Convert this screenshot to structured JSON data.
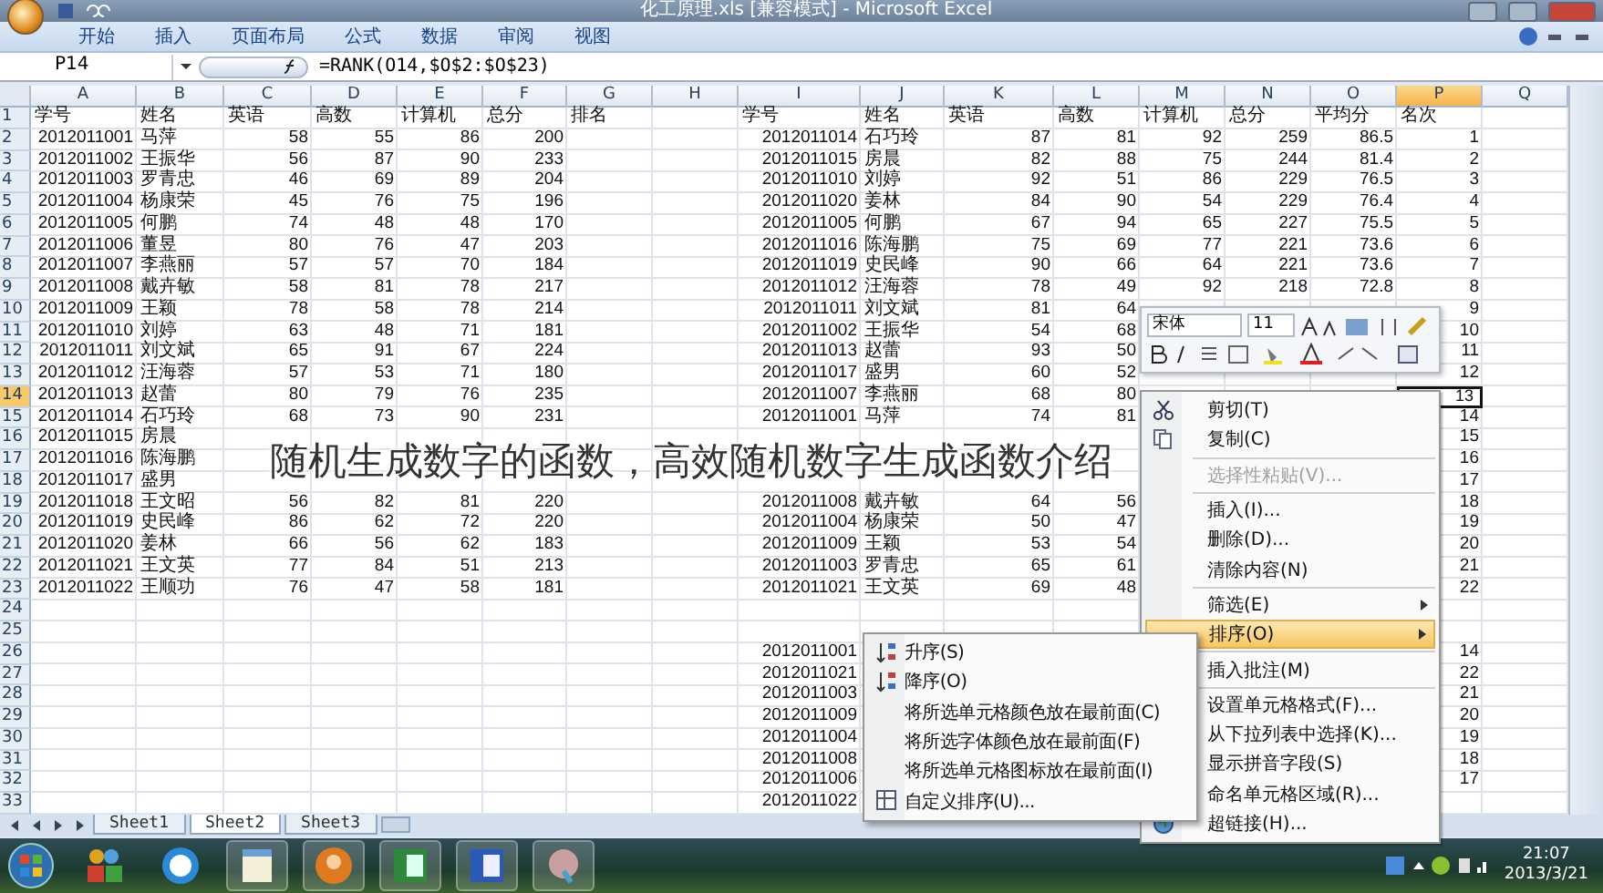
{
  "window": {
    "title": "化工原理.xls [兼容模式] - Microsoft Excel"
  },
  "ribbon_tabs": [
    "开始",
    "插入",
    "页面布局",
    "公式",
    "数据",
    "审阅",
    "视图"
  ],
  "formula_bar": {
    "name_box": "P14",
    "formula": "=RANK(O14,$O$2:$O$23)"
  },
  "columns": [
    {
      "label": "A",
      "selected": false
    },
    {
      "label": "B",
      "selected": false
    },
    {
      "label": "C",
      "selected": false
    },
    {
      "label": "D",
      "selected": false
    },
    {
      "label": "E",
      "selected": false
    },
    {
      "label": "F",
      "selected": false
    },
    {
      "label": "G",
      "selected": false
    },
    {
      "label": "H",
      "selected": false
    },
    {
      "label": "I",
      "selected": false
    },
    {
      "label": "J",
      "selected": false
    },
    {
      "label": "K",
      "selected": false
    },
    {
      "label": "L",
      "selected": false
    },
    {
      "label": "M",
      "selected": false
    },
    {
      "label": "N",
      "selected": false
    },
    {
      "label": "O",
      "selected": false
    },
    {
      "label": "P",
      "selected": true
    },
    {
      "label": "Q",
      "selected": false
    }
  ],
  "rows": [
    {
      "header": "1",
      "selected": false,
      "cells": {
        "A": "学号",
        "B": "姓名",
        "C": "英语",
        "D": "高数",
        "E": "计算机",
        "F": "总分",
        "G": "排名",
        "I": "学号",
        "J": "姓名",
        "K": "英语",
        "L": "高数",
        "M": "计算机",
        "N": "总分",
        "O": "平均分",
        "P": "名次"
      }
    },
    {
      "header": "2",
      "selected": false,
      "cells": {
        "A": "2012011001",
        "B": "马萍",
        "C": "58",
        "D": "55",
        "E": "86",
        "F": "200",
        "I": "2012011014",
        "J": "石巧玲",
        "K": "87",
        "L": "81",
        "M": "92",
        "N": "259",
        "O": "86.5",
        "P": "1"
      }
    },
    {
      "header": "3",
      "selected": false,
      "cells": {
        "A": "2012011002",
        "B": "王振华",
        "C": "56",
        "D": "87",
        "E": "90",
        "F": "233",
        "I": "2012011015",
        "J": "房晨",
        "K": "82",
        "L": "88",
        "M": "75",
        "N": "244",
        "O": "81.4",
        "P": "2"
      }
    },
    {
      "header": "4",
      "selected": false,
      "cells": {
        "A": "2012011003",
        "B": "罗青忠",
        "C": "46",
        "D": "69",
        "E": "89",
        "F": "204",
        "I": "2012011010",
        "J": "刘婷",
        "K": "92",
        "L": "51",
        "M": "86",
        "N": "229",
        "O": "76.5",
        "P": "3"
      }
    },
    {
      "header": "5",
      "selected": false,
      "cells": {
        "A": "2012011004",
        "B": "杨康荣",
        "C": "45",
        "D": "76",
        "E": "75",
        "F": "196",
        "I": "2012011020",
        "J": "姜林",
        "K": "84",
        "L": "90",
        "M": "54",
        "N": "229",
        "O": "76.4",
        "P": "4"
      }
    },
    {
      "header": "6",
      "selected": false,
      "cells": {
        "A": "2012011005",
        "B": "何鹏",
        "C": "74",
        "D": "48",
        "E": "48",
        "F": "170",
        "I": "2012011005",
        "J": "何鹏",
        "K": "67",
        "L": "94",
        "M": "65",
        "N": "227",
        "O": "75.5",
        "P": "5"
      }
    },
    {
      "header": "7",
      "selected": false,
      "cells": {
        "A": "2012011006",
        "B": "董昱",
        "C": "80",
        "D": "76",
        "E": "47",
        "F": "203",
        "I": "2012011016",
        "J": "陈海鹏",
        "K": "75",
        "L": "69",
        "M": "77",
        "N": "221",
        "O": "73.6",
        "P": "6"
      }
    },
    {
      "header": "8",
      "selected": false,
      "cells": {
        "A": "2012011007",
        "B": "李燕丽",
        "C": "57",
        "D": "57",
        "E": "70",
        "F": "184",
        "I": "2012011019",
        "J": "史民峰",
        "K": "90",
        "L": "66",
        "M": "64",
        "N": "221",
        "O": "73.6",
        "P": "7"
      }
    },
    {
      "header": "9",
      "selected": false,
      "cells": {
        "A": "2012011008",
        "B": "戴卉敏",
        "C": "58",
        "D": "81",
        "E": "78",
        "F": "217",
        "I": "2012011012",
        "J": "汪海蓉",
        "K": "78",
        "L": "49",
        "M": "92",
        "N": "218",
        "O": "72.8",
        "P": "8"
      }
    },
    {
      "header": "10",
      "selected": false,
      "cells": {
        "A": "2012011009",
        "B": "王颖",
        "C": "78",
        "D": "58",
        "E": "78",
        "F": "214",
        "I": "2012011011",
        "J": "刘文斌",
        "K": "81",
        "L": "64",
        "P": "9"
      }
    },
    {
      "header": "11",
      "selected": false,
      "cells": {
        "A": "2012011010",
        "B": "刘婷",
        "C": "63",
        "D": "48",
        "E": "71",
        "F": "181",
        "I": "2012011002",
        "J": "王振华",
        "K": "54",
        "L": "68",
        "P": "10"
      }
    },
    {
      "header": "12",
      "selected": false,
      "cells": {
        "A": "2012011011",
        "B": "刘文斌",
        "C": "65",
        "D": "91",
        "E": "67",
        "F": "224",
        "I": "2012011013",
        "J": "赵蕾",
        "K": "93",
        "L": "50",
        "P": "11"
      }
    },
    {
      "header": "13",
      "selected": false,
      "cells": {
        "A": "2012011012",
        "B": "汪海蓉",
        "C": "57",
        "D": "53",
        "E": "71",
        "F": "180",
        "I": "2012011017",
        "J": "盛男",
        "K": "60",
        "L": "52",
        "P": "12"
      }
    },
    {
      "header": "14",
      "selected": true,
      "cells": {
        "A": "2012011013",
        "B": "赵蕾",
        "C": "80",
        "D": "79",
        "E": "76",
        "F": "235",
        "I": "2012011007",
        "J": "李燕丽",
        "K": "68",
        "L": "80",
        "P": "13"
      }
    },
    {
      "header": "15",
      "selected": false,
      "cells": {
        "A": "2012011014",
        "B": "石巧玲",
        "C": "68",
        "D": "73",
        "E": "90",
        "F": "231",
        "I": "2012011001",
        "J": "马萍",
        "K": "74",
        "L": "81",
        "P": "14"
      }
    },
    {
      "header": "16",
      "selected": false,
      "cells": {
        "A": "2012011015",
        "B": "房晨",
        "P": "15"
      }
    },
    {
      "header": "17",
      "selected": false,
      "cells": {
        "A": "2012011016",
        "B": "陈海鹏",
        "P": "16"
      }
    },
    {
      "header": "18",
      "selected": false,
      "cells": {
        "A": "2012011017",
        "B": "盛男",
        "P": "17"
      }
    },
    {
      "header": "19",
      "selected": false,
      "cells": {
        "A": "2012011018",
        "B": "王文昭",
        "C": "56",
        "D": "82",
        "E": "81",
        "F": "220",
        "I": "2012011008",
        "J": "戴卉敏",
        "K": "64",
        "L": "56",
        "P": "18"
      }
    },
    {
      "header": "20",
      "selected": false,
      "cells": {
        "A": "2012011019",
        "B": "史民峰",
        "C": "86",
        "D": "62",
        "E": "72",
        "F": "220",
        "I": "2012011004",
        "J": "杨康荣",
        "K": "50",
        "L": "47",
        "P": "19"
      }
    },
    {
      "header": "21",
      "selected": false,
      "cells": {
        "A": "2012011020",
        "B": "姜林",
        "C": "66",
        "D": "56",
        "E": "62",
        "F": "183",
        "I": "2012011009",
        "J": "王颖",
        "K": "53",
        "L": "54",
        "P": "20"
      }
    },
    {
      "header": "22",
      "selected": false,
      "cells": {
        "A": "2012011021",
        "B": "王文英",
        "C": "77",
        "D": "84",
        "E": "51",
        "F": "213",
        "I": "2012011003",
        "J": "罗青忠",
        "K": "65",
        "L": "61",
        "P": "21"
      }
    },
    {
      "header": "23",
      "selected": false,
      "cells": {
        "A": "2012011022",
        "B": "王顺功",
        "C": "76",
        "D": "47",
        "E": "58",
        "F": "181",
        "I": "2012011021",
        "J": "王文英",
        "K": "69",
        "L": "48",
        "P": "22"
      }
    },
    {
      "header": "24",
      "selected": false
    },
    {
      "header": "25",
      "selected": false
    },
    {
      "header": "26",
      "selected": false,
      "cells": {
        "I": "2012011001",
        "P": "14"
      }
    },
    {
      "header": "27",
      "selected": false,
      "cells": {
        "I": "2012011021",
        "P": "22"
      }
    },
    {
      "header": "28",
      "selected": false,
      "cells": {
        "I": "2012011003",
        "P": "21"
      }
    },
    {
      "header": "29",
      "selected": false,
      "cells": {
        "I": "2012011009",
        "P": "20"
      }
    },
    {
      "header": "30",
      "selected": false,
      "cells": {
        "I": "2012011004",
        "P": "19"
      }
    },
    {
      "header": "31",
      "selected": false,
      "cells": {
        "I": "2012011008",
        "P": "18"
      }
    },
    {
      "header": "32",
      "selected": false,
      "cells": {
        "I": "2012011006",
        "P": "17"
      }
    },
    {
      "header": "33",
      "selected": false,
      "cells": {
        "I": "2012011022"
      }
    }
  ],
  "sheet_tabs": [
    {
      "label": "Sheet1",
      "selected": false
    },
    {
      "label": "Sheet2",
      "selected": true
    },
    {
      "label": "Sheet3",
      "selected": false
    }
  ],
  "mini_toolbar": {
    "font": "宋体",
    "size": "11"
  },
  "context_menu": [
    {
      "kind": "item",
      "label": "剪切(T)",
      "disabled": false,
      "highlighted": false,
      "submenu": false
    },
    {
      "kind": "item",
      "label": "复制(C)",
      "disabled": false,
      "highlighted": false,
      "submenu": false
    },
    {
      "kind": "separator"
    },
    {
      "kind": "item",
      "label": "选择性粘贴(V)...",
      "disabled": true,
      "highlighted": false,
      "submenu": false
    },
    {
      "kind": "separator"
    },
    {
      "kind": "item",
      "label": "插入(I)...",
      "disabled": false,
      "highlighted": false,
      "submenu": false
    },
    {
      "kind": "item",
      "label": "删除(D)...",
      "disabled": false,
      "highlighted": false,
      "submenu": false
    },
    {
      "kind": "item",
      "label": "清除内容(N)",
      "disabled": false,
      "highlighted": false,
      "submenu": false
    },
    {
      "kind": "separator"
    },
    {
      "kind": "item",
      "label": "筛选(E)",
      "disabled": false,
      "highlighted": false,
      "submenu": true
    },
    {
      "kind": "item",
      "label": "排序(O)",
      "disabled": false,
      "highlighted": true,
      "submenu": true
    },
    {
      "kind": "separator"
    },
    {
      "kind": "item",
      "label": "插入批注(M)",
      "disabled": false,
      "highlighted": false,
      "submenu": false
    },
    {
      "kind": "separator"
    },
    {
      "kind": "item",
      "label": "设置单元格格式(F)...",
      "disabled": false,
      "highlighted": false,
      "submenu": false
    },
    {
      "kind": "item",
      "label": "从下拉列表中选择(K)...",
      "disabled": false,
      "highlighted": false,
      "submenu": false
    },
    {
      "kind": "item",
      "label": "显示拼音字段(S)",
      "disabled": false,
      "highlighted": false,
      "submenu": false
    },
    {
      "kind": "item",
      "label": "命名单元格区域(R)...",
      "disabled": false,
      "highlighted": false,
      "submenu": false
    },
    {
      "kind": "item",
      "label": "超链接(H)...",
      "disabled": false,
      "highlighted": false,
      "submenu": false
    }
  ],
  "sort_submenu": [
    "升序(S)",
    "降序(O)",
    "将所选单元格颜色放在最前面(C)",
    "将所选字体颜色放在最前面(F)",
    "将所选单元格图标放在最前面(I)",
    "自定义排序(U)..."
  ],
  "caption": "随机生成数字的函数，高效随机数字生成函数介绍",
  "taskbar": {
    "time": "21:07",
    "date": "2013/3/21"
  }
}
